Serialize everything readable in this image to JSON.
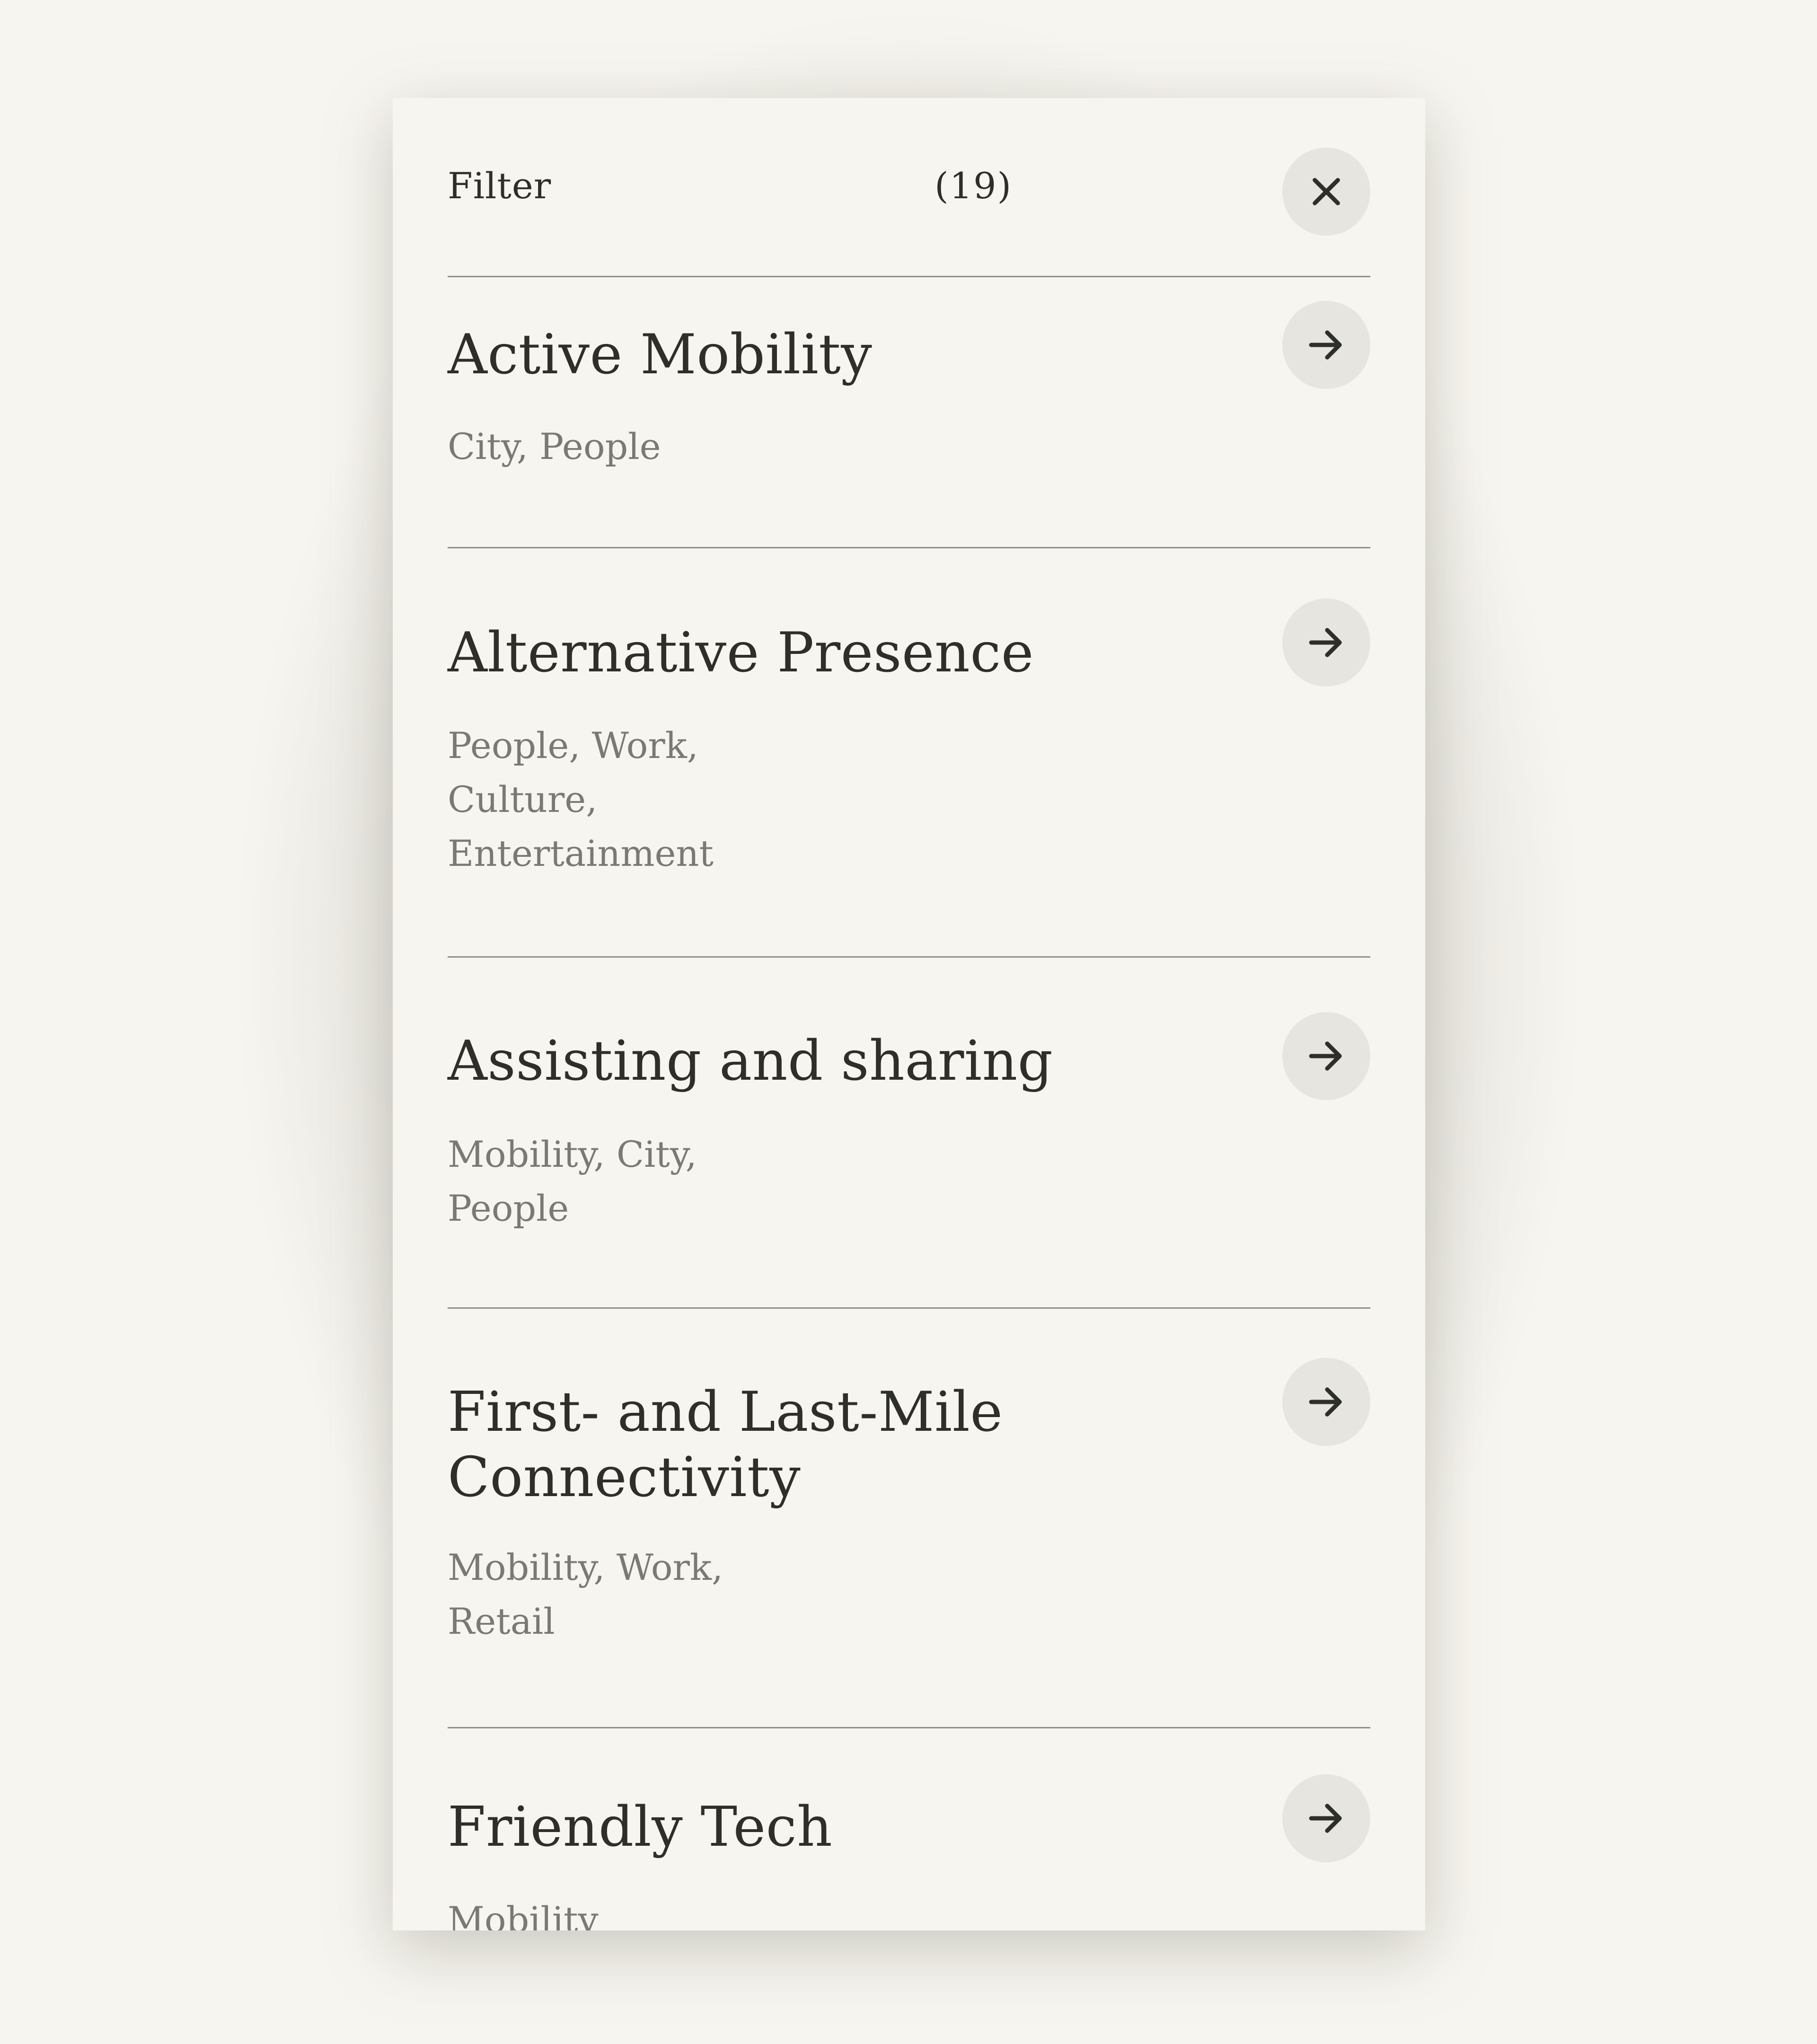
{
  "filter_panel": {
    "title": "Filter",
    "count": "(19)",
    "close_icon": "close-icon",
    "items": [
      {
        "title": "Active Mobility",
        "tags": "City, People",
        "icon": "arrow-right-icon"
      },
      {
        "title": "Alternative Presence",
        "tags": "People, Work, Culture, Entertainment",
        "icon": "arrow-right-icon"
      },
      {
        "title": "Assisting and sharing",
        "tags": "Mobility, City, People",
        "icon": "arrow-right-icon"
      },
      {
        "title": "First- and Last-Mile Connectivity",
        "tags": "Mobility, Work, Retail",
        "icon": "arrow-right-icon"
      },
      {
        "title": "Friendly Tech",
        "tags": "Mobility",
        "icon": "arrow-right-icon"
      }
    ]
  },
  "colors": {
    "background": "#f7f5ef",
    "button_fill": "#e6e5df",
    "text": "#2e2e2b",
    "muted_text": "#7a7975",
    "divider": "#8f8e89"
  }
}
